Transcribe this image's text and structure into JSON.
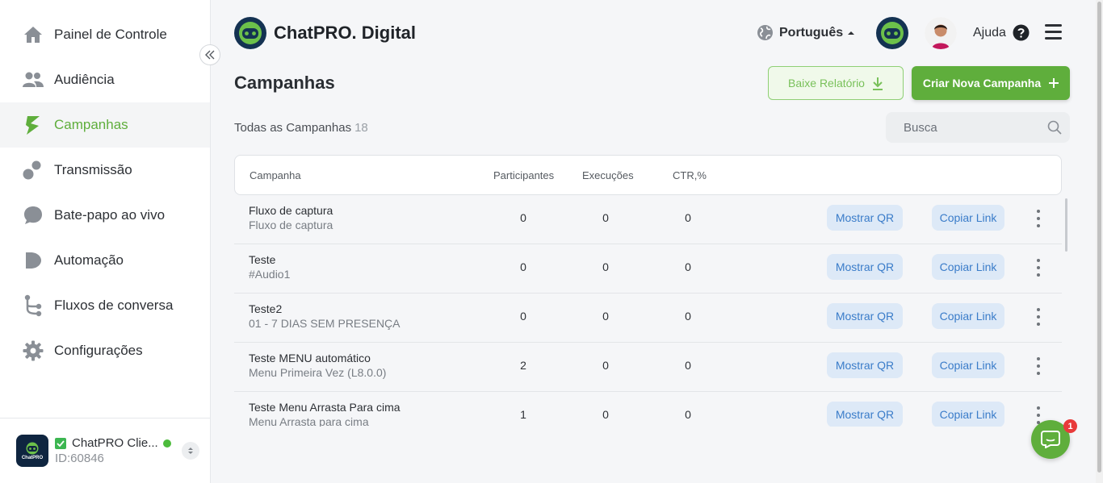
{
  "sidebar": {
    "items": [
      {
        "label": "Painel de Controle",
        "icon": "home-icon"
      },
      {
        "label": "Audiência",
        "icon": "users-icon"
      },
      {
        "label": "Campanhas",
        "icon": "campaign-icon",
        "active": true
      },
      {
        "label": "Transmissão",
        "icon": "broadcast-icon"
      },
      {
        "label": "Bate-papo ao vivo",
        "icon": "chat-bubble-icon"
      },
      {
        "label": "Automação",
        "icon": "automation-icon"
      },
      {
        "label": "Fluxos de conversa",
        "icon": "flow-icon"
      },
      {
        "label": "Configurações",
        "icon": "gear-icon"
      }
    ],
    "account": {
      "name": "ChatPRO Clie...",
      "id": "ID:60846",
      "logo_text": "ChatPRO"
    }
  },
  "header": {
    "brand": "ChatPRO. Digital",
    "language": "Português",
    "help": "Ajuda"
  },
  "main": {
    "title": "Campanhas",
    "report_button": "Baixe Relatório",
    "new_button": "Criar Nova Campanha",
    "all_label": "Todas as Campanhas",
    "all_count": "18",
    "search_placeholder": "Busca",
    "columns": {
      "campaign": "Campanha",
      "participants": "Participantes",
      "executions": "Execuções",
      "ctr": "CTR,%"
    },
    "rows": [
      {
        "name": "Fluxo de captura",
        "sub": "Fluxo de captura",
        "participants": "0",
        "executions": "0",
        "ctr": "0"
      },
      {
        "name": "Teste",
        "sub": "#Audio1",
        "participants": "0",
        "executions": "0",
        "ctr": "0"
      },
      {
        "name": "Teste2",
        "sub": "01 - 7 DIAS SEM PRESENÇA",
        "participants": "0",
        "executions": "0",
        "ctr": "0"
      },
      {
        "name": "Teste MENU automático",
        "sub": "Menu Primeira Vez (L8.0.0)",
        "participants": "2",
        "executions": "0",
        "ctr": "0"
      },
      {
        "name": "Teste Menu Arrasta Para cima",
        "sub": "Menu Arrasta para cima",
        "participants": "1",
        "executions": "0",
        "ctr": "0"
      }
    ],
    "show_qr": "Mostrar QR",
    "copy_link": "Copiar Link"
  },
  "chat_widget": {
    "badge": "1"
  },
  "colors": {
    "accent": "#5fae3c",
    "pill_bg": "#dde9f7",
    "pill_text": "#3a7cc9",
    "brand_dark": "#143252"
  }
}
